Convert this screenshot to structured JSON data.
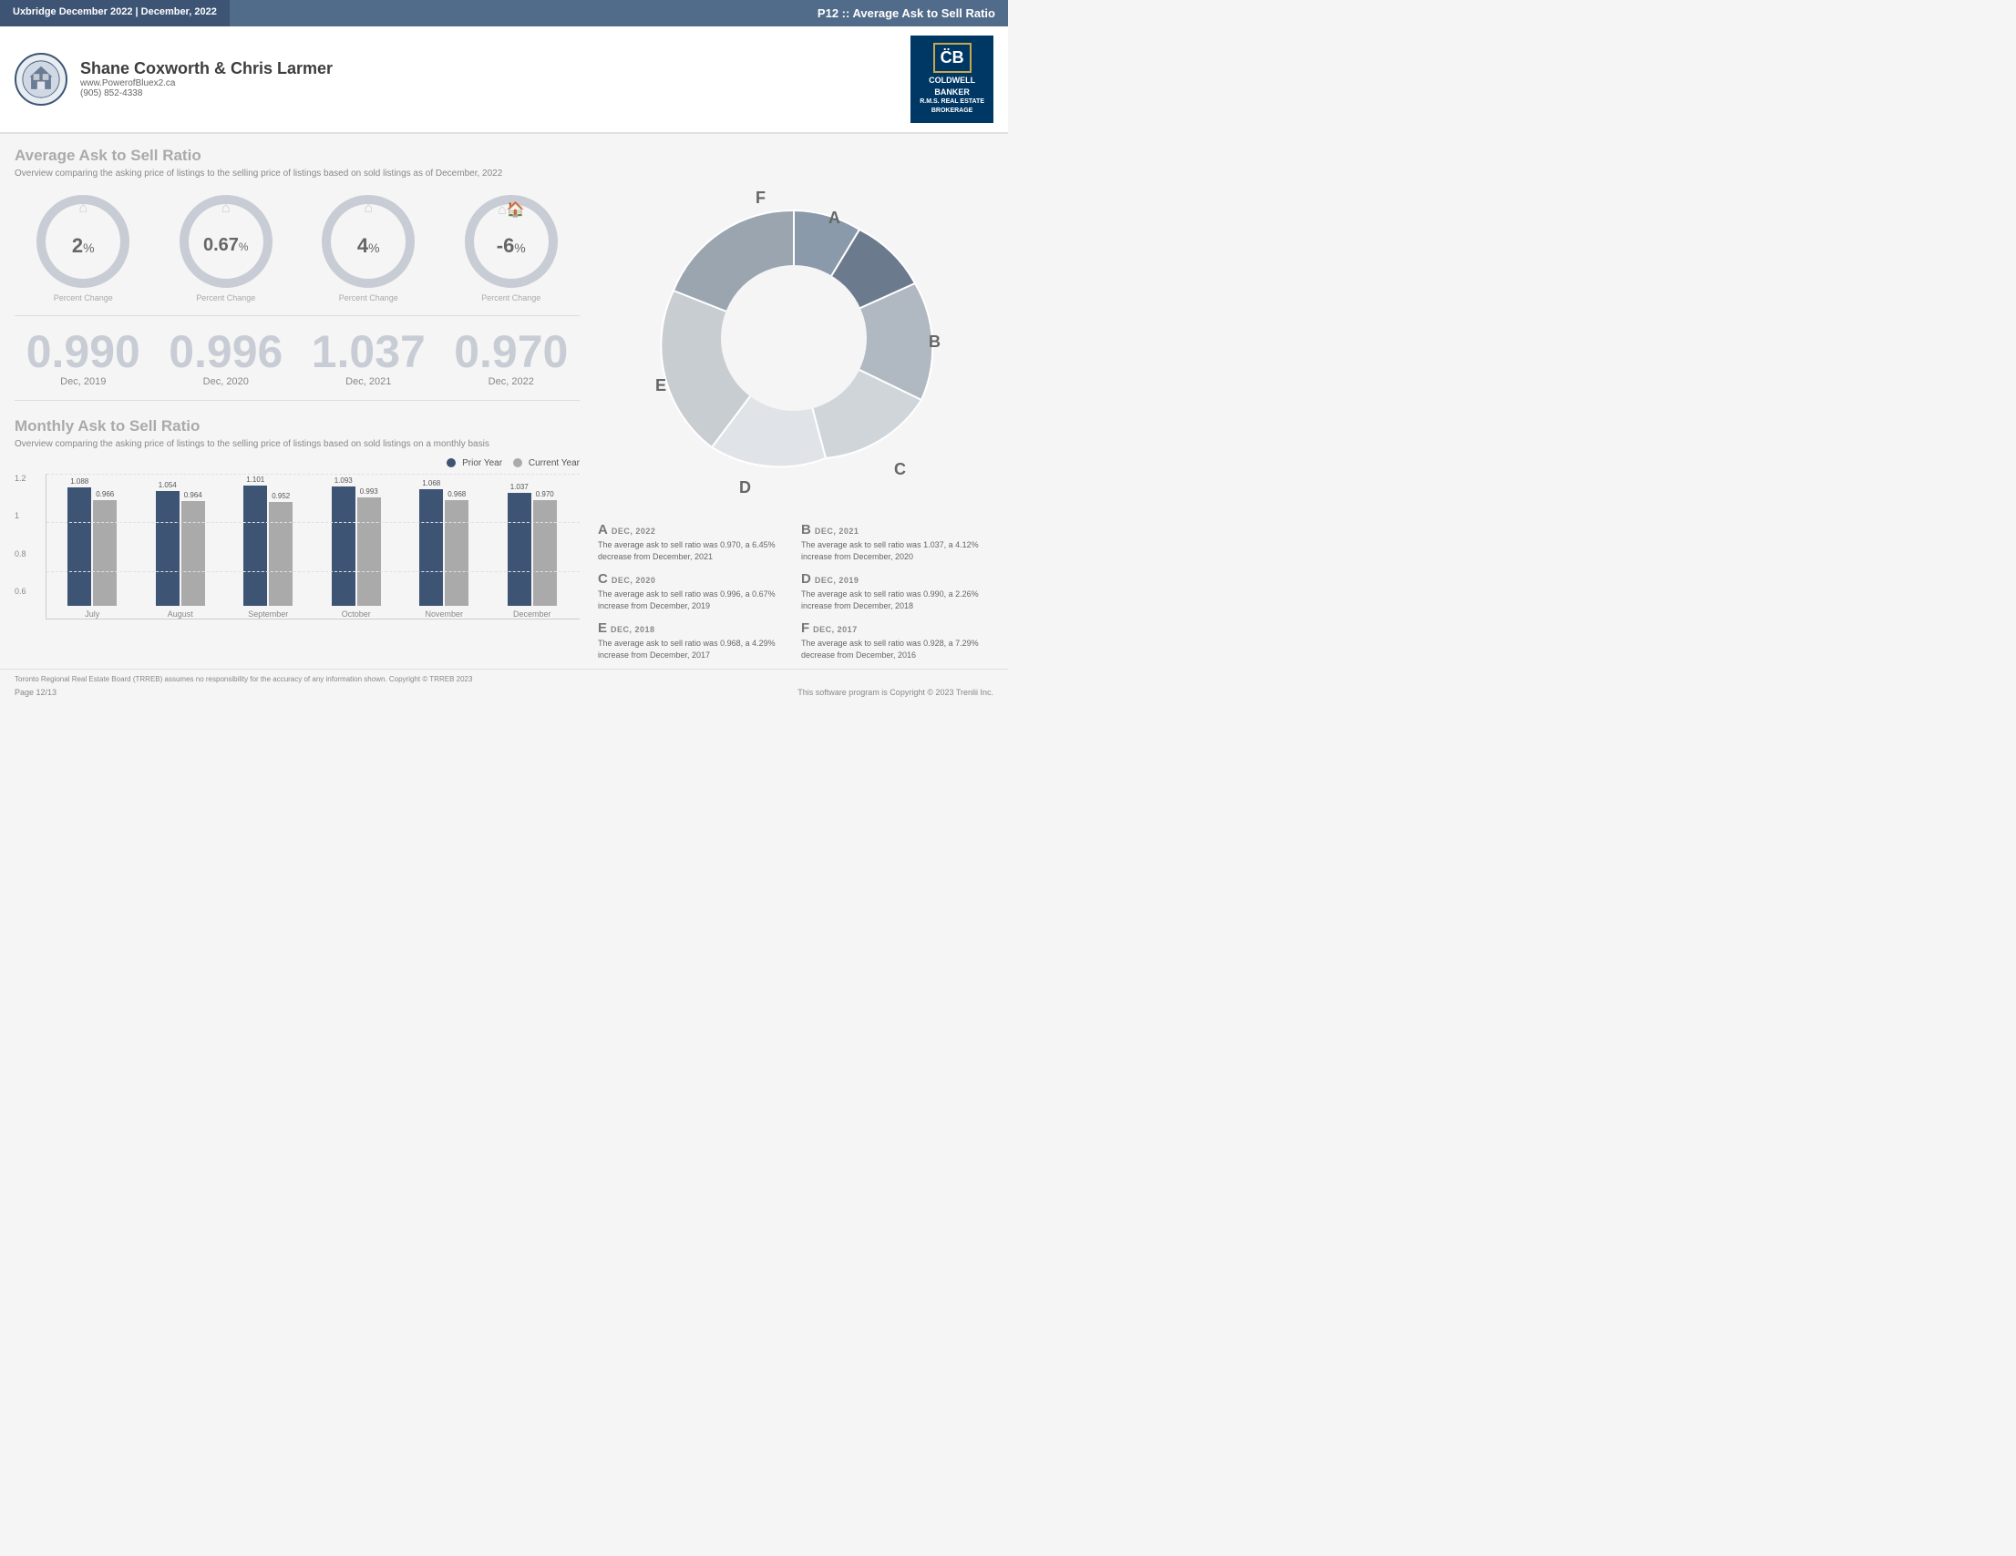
{
  "header": {
    "left_title": "Uxbridge December 2022 | December, 2022",
    "right_title": "P12 :: Average Ask to Sell Ratio"
  },
  "agent": {
    "name": "Shane Coxworth & Chris Larmer",
    "website": "www.PowerofBluex2.ca",
    "phone": "(905) 852-4338"
  },
  "coldwell": {
    "line1": "COLDWELL",
    "line2": "BANKER",
    "line3": "R.M.S. REAL ESTATE",
    "line4": "BROKERAGE"
  },
  "avg_ask_sell": {
    "title": "Average Ask to Sell Ratio",
    "desc": "Overview comparing the asking price of listings to the selling price of listings based on sold listings as of December, 2022",
    "gauges": [
      {
        "value": "2",
        "pct": "%",
        "label": "Percent Change"
      },
      {
        "value": "0.67",
        "pct": "%",
        "label": "Percent Change"
      },
      {
        "value": "4",
        "pct": "%",
        "label": "Percent Change"
      },
      {
        "value": "-6",
        "pct": "%",
        "label": "Percent Change"
      }
    ],
    "big_numbers": [
      {
        "value": "0.990",
        "label": "Dec, 2019"
      },
      {
        "value": "0.996",
        "label": "Dec, 2020"
      },
      {
        "value": "1.037",
        "label": "Dec, 2021"
      },
      {
        "value": "0.970",
        "label": "Dec, 2022"
      }
    ]
  },
  "monthly": {
    "title": "Monthly Ask to Sell Ratio",
    "desc": "Overview comparing the asking price of listings to the selling price of listings based on sold listings on a monthly basis",
    "legend": {
      "prior_year": "Prior Year",
      "current_year": "Current Year"
    },
    "colors": {
      "prior": "#3d5474",
      "current": "#aaa"
    },
    "y_axis": [
      "1.2",
      "1",
      "0.8",
      "0.6"
    ],
    "bars": [
      {
        "month": "July",
        "prior": 1.088,
        "current": 0.966,
        "prior_h": 130,
        "current_h": 116
      },
      {
        "month": "August",
        "prior": 1.054,
        "current": 0.964,
        "prior_h": 126,
        "current_h": 115
      },
      {
        "month": "September",
        "prior": 1.101,
        "current": 0.952,
        "prior_h": 132,
        "current_h": 114
      },
      {
        "month": "October",
        "prior": 1.093,
        "current": 0.993,
        "prior_h": 131,
        "current_h": 119
      },
      {
        "month": "November",
        "prior": 1.068,
        "current": 0.968,
        "prior_h": 128,
        "current_h": 116
      },
      {
        "month": "December",
        "prior": 1.037,
        "current": 0.97,
        "prior_h": 124,
        "current_h": 116
      }
    ]
  },
  "donut": {
    "segments": [
      {
        "label": "A",
        "value": 15,
        "color": "#6b7a8d",
        "label_x": 285,
        "label_y": 80
      },
      {
        "label": "B",
        "value": 20,
        "color": "#b0b8c1",
        "label_x": 350,
        "label_y": 200
      },
      {
        "label": "C",
        "value": 18,
        "color": "#d0d5da",
        "label_x": 310,
        "label_y": 330
      },
      {
        "label": "D",
        "value": 16,
        "color": "#e8eaec",
        "label_x": 165,
        "label_y": 345
      },
      {
        "label": "E",
        "value": 14,
        "color": "#c8cdd2",
        "label_x": 80,
        "label_y": 230
      },
      {
        "label": "F",
        "value": 17,
        "color": "#9aa5b0",
        "label_x": 160,
        "label_y": 70
      }
    ]
  },
  "legend_descriptions": [
    {
      "letter": "A",
      "date": "DEC, 2022",
      "text": "The average ask to sell ratio was 0.970, a 6.45% decrease from December, 2021"
    },
    {
      "letter": "B",
      "date": "DEC, 2021",
      "text": "The average ask to sell ratio was 1.037, a 4.12% increase from December, 2020"
    },
    {
      "letter": "C",
      "date": "DEC, 2020",
      "text": "The average ask to sell ratio was 0.996, a 0.67% increase from December, 2019"
    },
    {
      "letter": "D",
      "date": "DEC, 2019",
      "text": "The average ask to sell ratio was 0.990, a 2.26% increase from December, 2018"
    },
    {
      "letter": "E",
      "date": "DEC, 2018",
      "text": "The average ask to sell ratio was 0.968, a 4.29% increase from December, 2017"
    },
    {
      "letter": "F",
      "date": "DEC, 2017",
      "text": "The average ask to sell ratio was 0.928, a 7.29% decrease from December, 2016"
    }
  ],
  "footer": {
    "disclaimer": "Toronto Regional Real Estate Board (TRREB) assumes no responsibility for the accuracy of any information shown. Copyright © TRREB 2023",
    "page": "Page 12/13",
    "copyright": "This software program is Copyright © 2023 Trenlii Inc."
  }
}
